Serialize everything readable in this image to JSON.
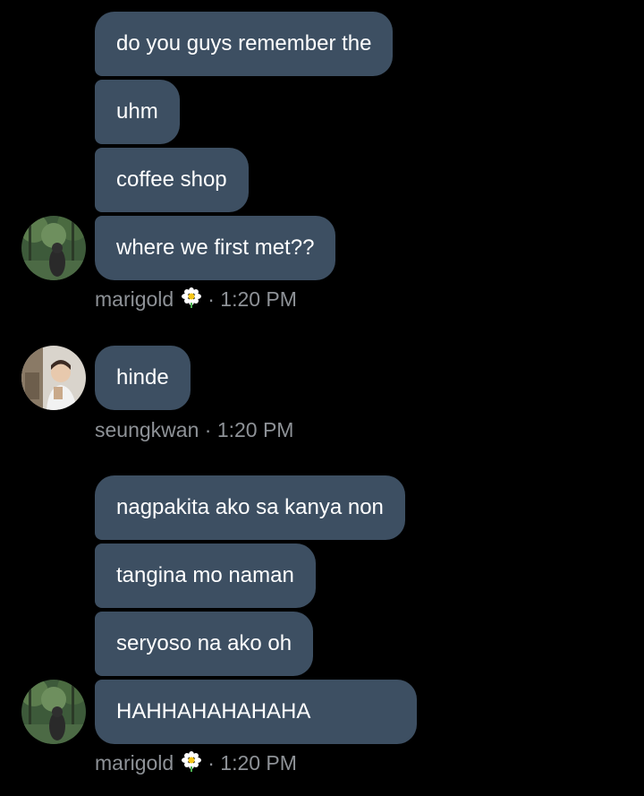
{
  "groups": [
    {
      "sender": "marigold",
      "has_flower": true,
      "time": "1:20 PM",
      "messages": [
        "do you guys remember the",
        "uhm",
        "coffee shop",
        "where we first met??"
      ]
    },
    {
      "sender": "seungkwan",
      "has_flower": false,
      "time": "1:20 PM",
      "messages": [
        "hinde"
      ]
    },
    {
      "sender": "marigold",
      "has_flower": true,
      "time": "1:20 PM",
      "messages": [
        "nagpakita ako sa kanya non",
        "tangina mo naman",
        "seryoso na ako oh",
        "HAHHAHAHAHAHA"
      ]
    }
  ],
  "separator": "·",
  "colors": {
    "background": "#000000",
    "bubble": "#3d4f62",
    "text": "#ffffff",
    "meta": "#8e9297"
  },
  "icons": {
    "flower": "daisy-emoji-icon"
  }
}
